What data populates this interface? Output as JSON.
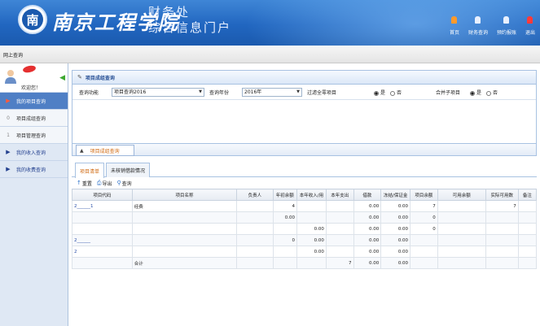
{
  "header": {
    "school_name": "南京工程学院",
    "emblem_char": "南",
    "portal_line1": "财务处",
    "portal_line2": "综合信息门户",
    "nav": [
      {
        "label": "首页",
        "color": "#ff9a2a"
      },
      {
        "label": "财务查询",
        "color": "#e8f0ff"
      },
      {
        "label": "预约报账",
        "color": "#e8f0ff"
      },
      {
        "label": "退出",
        "color": "#ff3a3a"
      }
    ]
  },
  "topbar": {
    "label": "网上查询"
  },
  "sidebar": {
    "welcome": "欢迎您！",
    "items": [
      {
        "icon": "▶",
        "label": "我的项目查询"
      },
      {
        "icon": "0",
        "label": "项目成组查询"
      },
      {
        "icon": "1",
        "label": "项目管理查询"
      },
      {
        "icon": "▶",
        "label": "我的收入查询"
      },
      {
        "icon": "▶",
        "label": "我的收费查询"
      }
    ]
  },
  "panel": {
    "title": "项目成组查询"
  },
  "filter": {
    "func_label": "查询功能",
    "func_value": "项目查询2016",
    "year_label": "查询年份",
    "year_value": "2016年",
    "zero_label": "过滤全零项目",
    "merge_label": "合并子项目",
    "yes": "是",
    "no": "否"
  },
  "collapse_tab": "项目成组查询",
  "tabs": [
    "项目清单",
    "未核销借款情况"
  ],
  "toolbar": {
    "reset": "重置",
    "export": "导出",
    "query": "查询"
  },
  "table": {
    "headers": [
      "项目代码",
      "项目名称",
      "负责人",
      "年初余额",
      "本年收入/用",
      "本年支出",
      "借款",
      "冻结/保证金",
      "项目余额",
      "可用余额",
      "实际可用数",
      "备注"
    ],
    "rows": [
      [
        "2______1",
        "经费",
        "",
        "4",
        "",
        "",
        "0.00",
        "0.00",
        "7",
        "",
        "7",
        ""
      ],
      [
        "",
        "",
        "",
        "0.00",
        "",
        "",
        "0.00",
        "0.00",
        "0",
        "",
        "",
        ""
      ],
      [
        "",
        "",
        "",
        "",
        "0.00",
        "",
        "0.00",
        "0.00",
        "0",
        "",
        "",
        ""
      ],
      [
        "2______",
        "",
        "",
        "0",
        "0.00",
        "",
        "0.00",
        "0.00",
        "",
        "",
        "",
        ""
      ],
      [
        "2",
        "",
        "",
        "",
        "0.00",
        "",
        "0.00",
        "0.00",
        "",
        "",
        "",
        ""
      ],
      [
        "",
        "合计",
        "",
        "",
        "",
        "7",
        "0.00",
        "0.00",
        "",
        "",
        "",
        ""
      ]
    ]
  }
}
